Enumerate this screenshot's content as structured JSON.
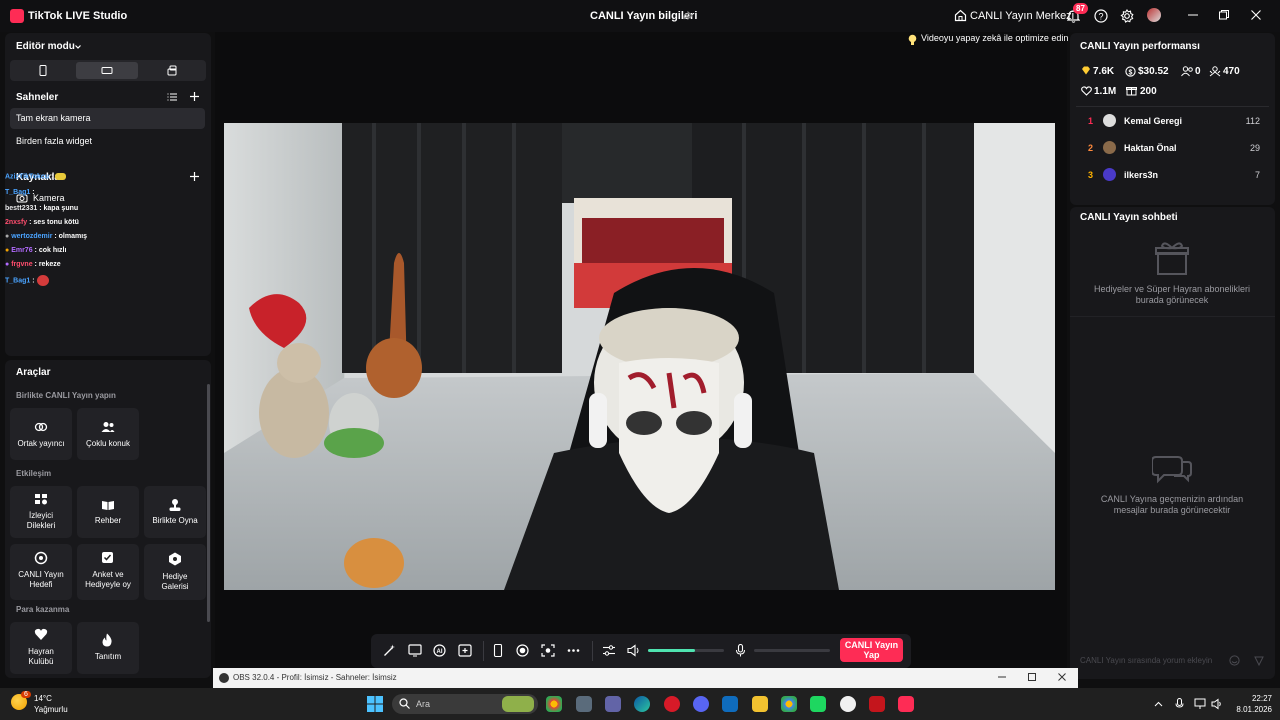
{
  "titlebar": {
    "app_title": "TikTok LIVE Studio",
    "stream_info": "CANLI Yayın bilgileri",
    "live_center": "CANLI Yayın Merkezi",
    "notification_count": "87"
  },
  "left": {
    "editor_mode": "Editör modu",
    "scenes_title": "Sahneler",
    "scenes": [
      "Tam ekran kamera",
      "Birden fazla widget"
    ],
    "sources_title": "Kaynaklar",
    "camera_label": "Kamera",
    "chat_overlay": [
      {
        "user": "AzizTikTokcu",
        "text": ":",
        "color": "#4aa3ff"
      },
      {
        "user": "T_Bag1",
        "text": ":",
        "color": "#4aa3ff"
      },
      {
        "user": "bestt2331",
        "text": ": kapa şunu",
        "color": "#e8e8ea"
      },
      {
        "user": "2nxsfy",
        "text": ": ses tonu kötü",
        "color": "#ff4d6d"
      },
      {
        "user": "wertozdemir",
        "text": ": olmamış",
        "color": "#4aa3ff"
      },
      {
        "user": "Emr76",
        "text": ": cok hızlı",
        "color": "#b36bff"
      },
      {
        "user": "frgvne",
        "text": ": rekeze",
        "color": "#ff4d6d"
      },
      {
        "user": "T_Bag1",
        "text": ":",
        "color": "#4aa3ff"
      }
    ],
    "tools_title": "Araçlar",
    "sections": {
      "collab": "Birlikte CANLI Yayın yapın",
      "interaction": "Etkileşim",
      "monetize": "Para kazanma"
    },
    "tiles": {
      "cohost": "Ortak yayıncı",
      "multi_guest": "Çoklu konuk",
      "viewer_requests_1": "İzleyici",
      "viewer_requests_2": "Dilekleri",
      "guide": "Rehber",
      "play_together": "Birlikte Oyna",
      "live_goal_1": "CANLI Yayın",
      "live_goal_2": "Hedefi",
      "poll_1": "Anket ve",
      "poll_2": "Hediyeyle oy",
      "gift_gallery_1": "Hediye",
      "gift_gallery_2": "Galerisi",
      "fan_club_1": "Hayran",
      "fan_club_2": "Kulübü",
      "promote": "Tanıtım"
    }
  },
  "center": {
    "ai_optimize": "Videoyu yapay zekâ ile optimize edin",
    "go_live_1": "CANLI Yayın",
    "go_live_2": "Yap",
    "volume_level": 0.62
  },
  "right": {
    "perf_title": "CANLI Yayın performansı",
    "stats": {
      "diamonds": "7.6K",
      "earnings": "$30.52",
      "new_followers": "0",
      "viewers": "470",
      "likes": "1.1M",
      "gifters": "200"
    },
    "ranking": [
      {
        "rank": "1",
        "name": "Kemal Geregi",
        "value": "112",
        "rank_color": "#fe2c55"
      },
      {
        "rank": "2",
        "name": "Haktan Önal",
        "value": "29",
        "rank_color": "#ff8a3d"
      },
      {
        "rank": "3",
        "name": "ilkers3n",
        "value": "7",
        "rank_color": "#ffb300"
      }
    ],
    "chat_title": "CANLI Yayın sohbeti",
    "gift_empty": "Hediyeler ve Süper Hayran abonelikleri burada görünecek",
    "chat_empty": "CANLI Yayına geçmenizin ardından mesajlar burada görünecektir",
    "chat_placeholder": "CANLI Yayın sırasında yorum ekleyin"
  },
  "obs": {
    "title": "OBS 32.0.4 - Profil: İsimsiz - Sahneler: İsimsiz"
  },
  "taskbar": {
    "temp": "14°C",
    "condition": "Yağmurlu",
    "weather_badge": "6",
    "search": "Ara",
    "time": "22:27",
    "date": "8.01.2026"
  }
}
